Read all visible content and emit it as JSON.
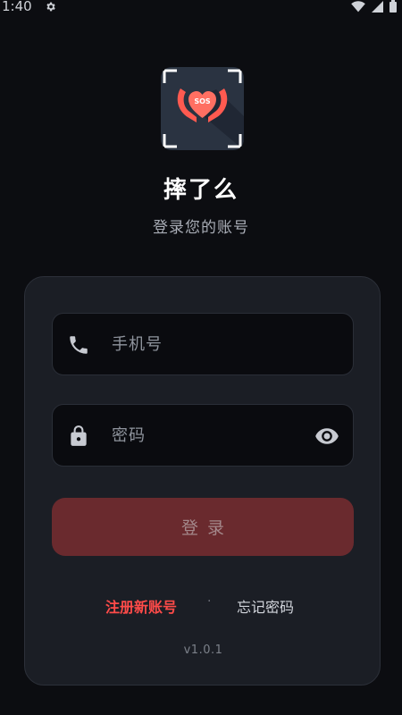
{
  "status_bar": {
    "time": "1:40",
    "icons": [
      "gear-icon",
      "wifi-icon",
      "signal-icon",
      "battery-icon"
    ]
  },
  "app": {
    "name": "摔了么",
    "subtitle": "登录您的账号",
    "logo_text": "SOS",
    "logo_icon": "heart-hands-icon"
  },
  "form": {
    "phone_placeholder": "手机号",
    "phone_value": "",
    "phone_icon": "phone-icon",
    "password_placeholder": "密码",
    "password_value": "",
    "password_icon": "lock-icon",
    "visibility_icon": "eye-icon",
    "login_label": "登录"
  },
  "links": {
    "register": "注册新账号",
    "separator": "·",
    "forgot": "忘记密码"
  },
  "version": "v1.0.1",
  "colors": {
    "background": "#0c0d11",
    "card": "#1b1e25",
    "input": "#0a0b0f",
    "button": "#6a2a2e",
    "accent": "#ff4b49"
  }
}
